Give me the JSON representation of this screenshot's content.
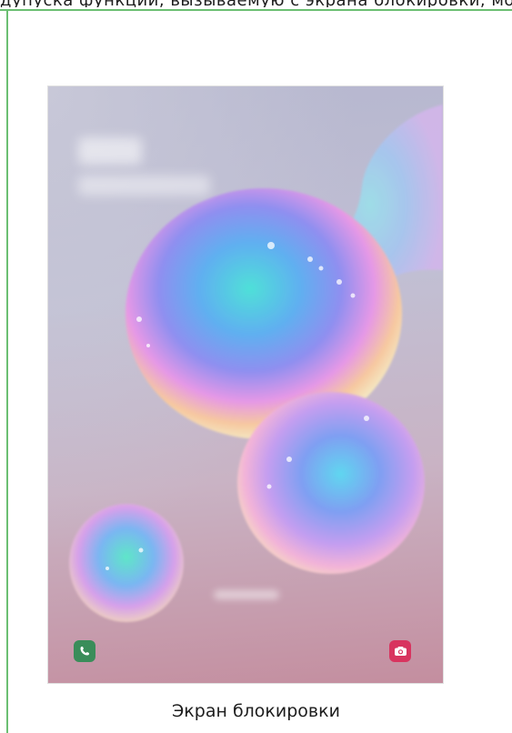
{
  "top_text": "дупуска функции, вызываемую с экрана блокировки, можно изменить",
  "lock_screen": {
    "phone_shortcut_icon": "phone-icon",
    "camera_shortcut_icon": "camera-icon",
    "accent_phone": "#3a8d5a",
    "accent_camera": "#d8345f"
  },
  "caption": "Экран блокировки"
}
